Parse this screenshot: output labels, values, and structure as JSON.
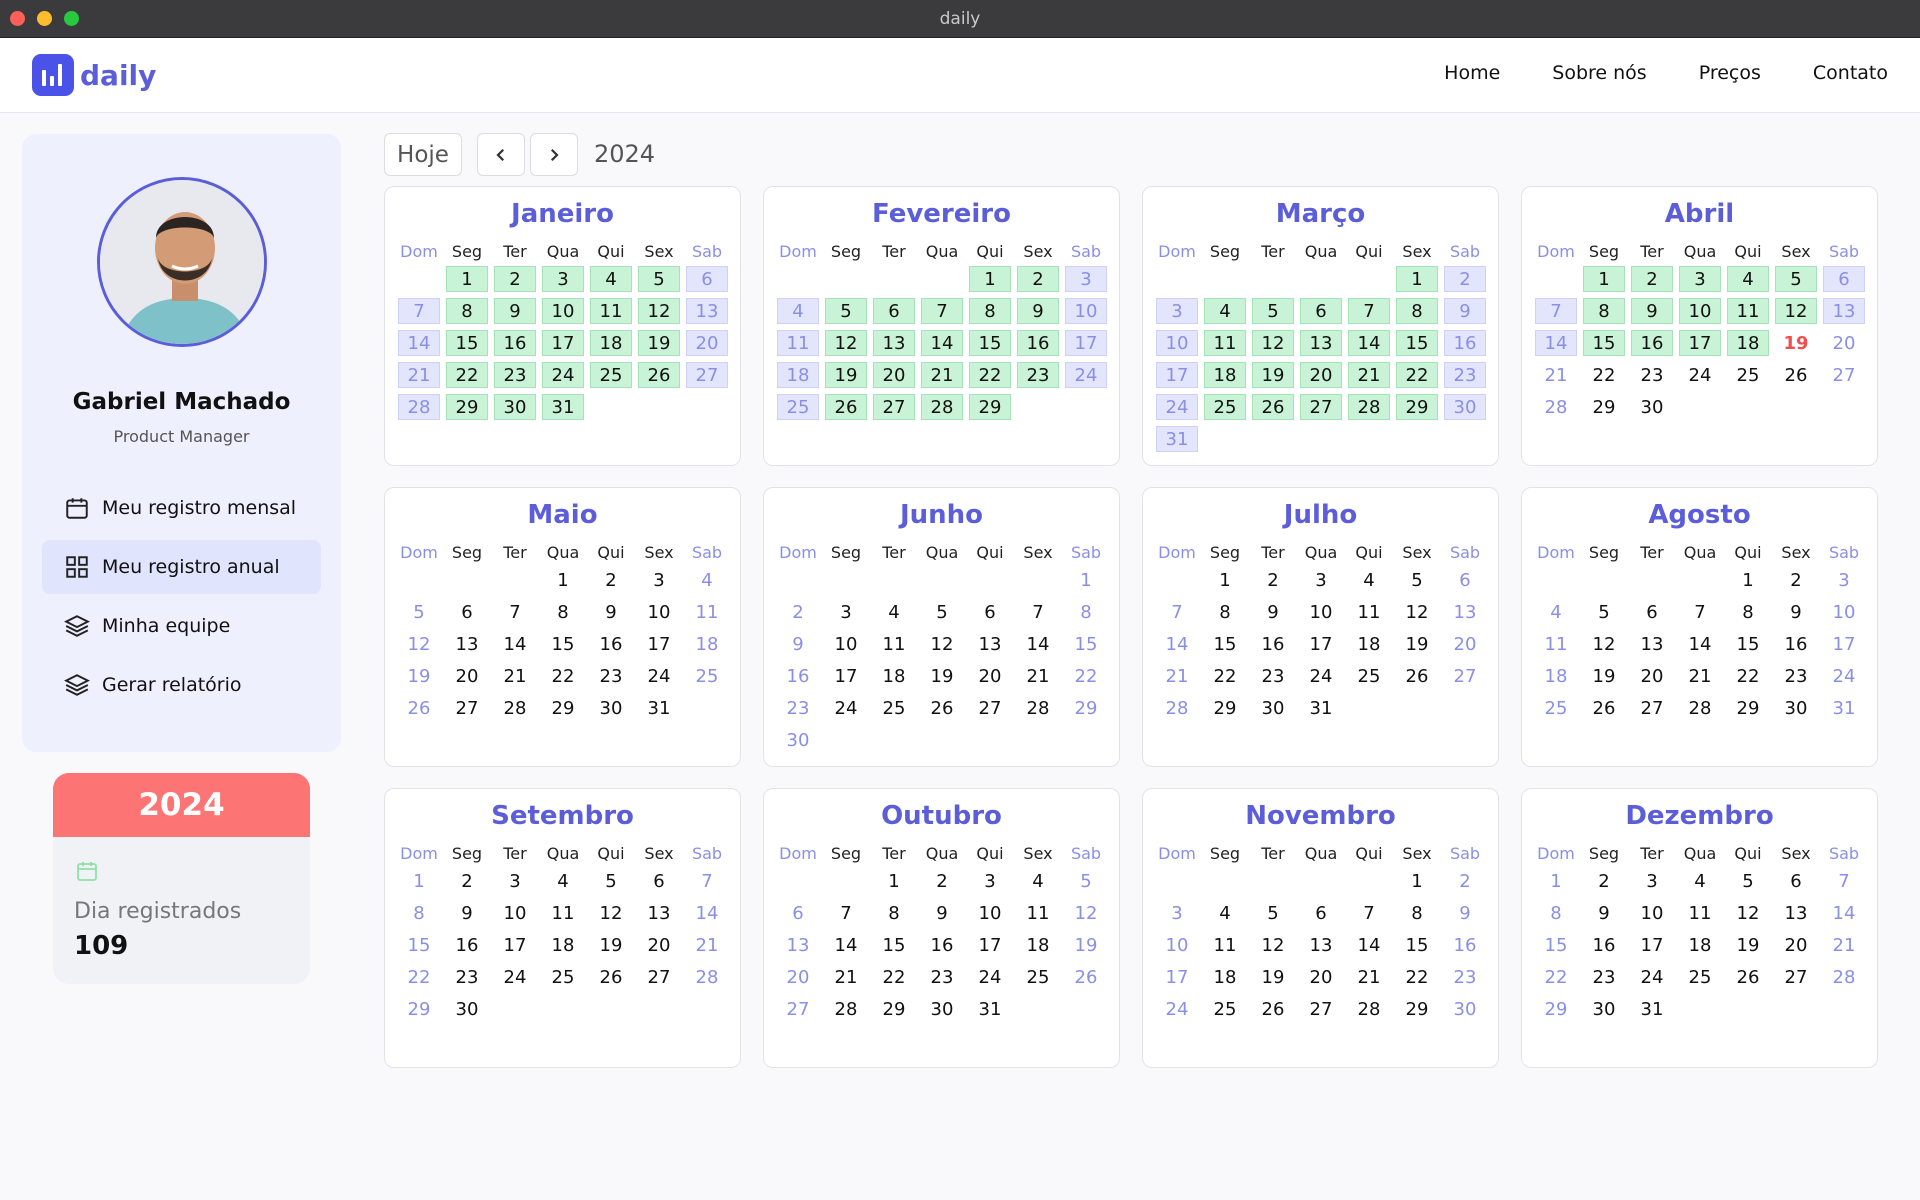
{
  "window": {
    "title": "daily"
  },
  "header": {
    "logo_text": "daily",
    "nav": [
      "Home",
      "Sobre nós",
      "Preços",
      "Contato"
    ]
  },
  "user": {
    "name": "Gabriel Machado",
    "role": "Product Manager"
  },
  "sidebar": {
    "items": [
      {
        "label": "Meu registro mensal",
        "icon": "calendar-icon",
        "active": false
      },
      {
        "label": "Meu registro anual",
        "icon": "grid-icon",
        "active": true
      },
      {
        "label": "Minha equipe",
        "icon": "layers-icon",
        "active": false
      },
      {
        "label": "Gerar relatório",
        "icon": "layers-icon",
        "active": false
      }
    ]
  },
  "year_card": {
    "year": "2024",
    "label": "Dia registrados",
    "count": "109"
  },
  "toolbar": {
    "today_label": "Hoje",
    "year": "2024"
  },
  "weekdays": [
    "Dom",
    "Seg",
    "Ter",
    "Qua",
    "Qui",
    "Sex",
    "Sab"
  ],
  "colors": {
    "accent": "#5b5ed8",
    "registered": "#c9f3d6",
    "weekend_registered": "#e3e5fc",
    "year_header": "#fc7474",
    "today": "#f04e4e"
  },
  "months": [
    {
      "name": "Janeiro",
      "start": 1,
      "days": 31,
      "registered_until": 31
    },
    {
      "name": "Fevereiro",
      "start": 4,
      "days": 29,
      "registered_until": 29
    },
    {
      "name": "Março",
      "start": 5,
      "days": 31,
      "registered_until": 31
    },
    {
      "name": "Abril",
      "start": 1,
      "days": 30,
      "registered_until": 18,
      "today": 19
    },
    {
      "name": "Maio",
      "start": 3,
      "days": 31,
      "registered_until": 0
    },
    {
      "name": "Junho",
      "start": 6,
      "days": 30,
      "registered_until": 0
    },
    {
      "name": "Julho",
      "start": 1,
      "days": 31,
      "registered_until": 0
    },
    {
      "name": "Agosto",
      "start": 4,
      "days": 31,
      "registered_until": 0
    },
    {
      "name": "Setembro",
      "start": 0,
      "days": 30,
      "registered_until": 0
    },
    {
      "name": "Outubro",
      "start": 2,
      "days": 31,
      "registered_until": 0
    },
    {
      "name": "Novembro",
      "start": 5,
      "days": 30,
      "registered_until": 0
    },
    {
      "name": "Dezembro",
      "start": 0,
      "days": 31,
      "registered_until": 0
    }
  ]
}
